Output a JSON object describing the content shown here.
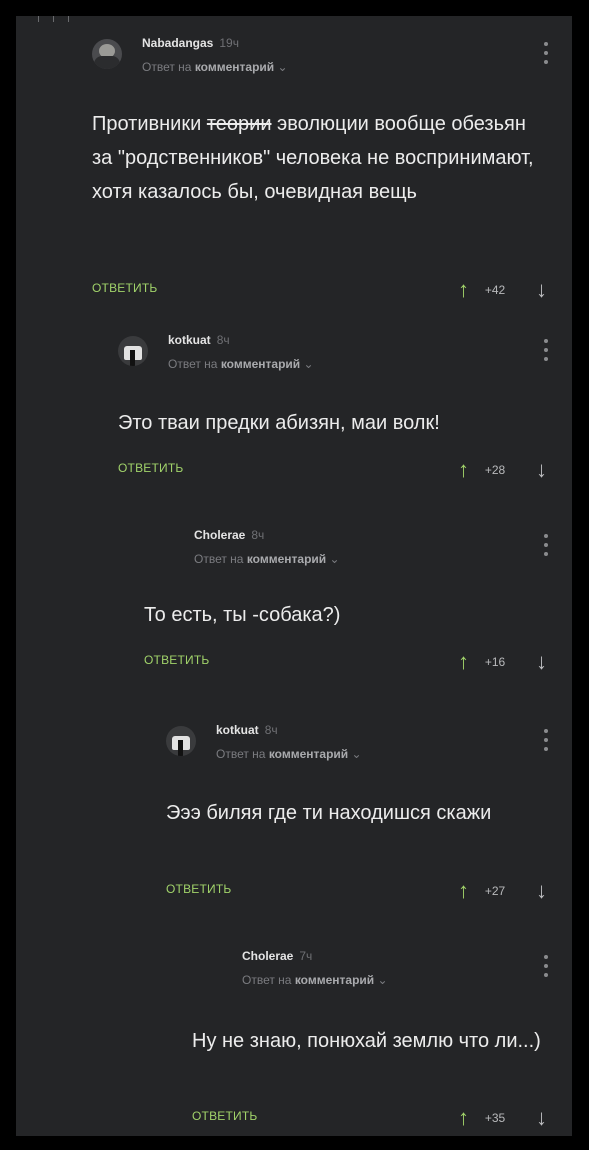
{
  "comments": [
    {
      "username": "Nabadangas",
      "time": "19ч",
      "reply_prefix": "Ответ на",
      "reply_link": "комментарий",
      "reply_chevron": "⌄",
      "text_before": "Противники ",
      "text_strike": "теории",
      "text_after": " эволюции вообще обезьян за \"родственников\" человека не воспринимают, хотя казалось бы, очевидная вещь",
      "reply_label": "ОТВЕТИТЬ",
      "score": "+42",
      "avatar_icon": "man-avatar"
    },
    {
      "username": "kotkuat",
      "time": "8ч",
      "reply_prefix": "Ответ на",
      "reply_link": "комментарий",
      "reply_chevron": "⌄",
      "text": "Это тваи предки абизян, маи волк!",
      "reply_label": "ОТВЕТИТЬ",
      "score": "+28",
      "avatar_icon": "cat-avatar"
    },
    {
      "username": "Cholerae",
      "time": "8ч",
      "reply_prefix": "Ответ на",
      "reply_link": "комментарий",
      "reply_chevron": "⌄",
      "text": "То есть, ты -собака?)",
      "reply_label": "ОТВЕТИТЬ",
      "score": "+16",
      "avatar_icon": "none"
    },
    {
      "username": "kotkuat",
      "time": "8ч",
      "reply_prefix": "Ответ на",
      "reply_link": "комментарий",
      "reply_chevron": "⌄",
      "text": "Эээ биляя где ти находишся скажи",
      "reply_label": "ОТВЕТИТЬ",
      "score": "+27",
      "avatar_icon": "cat-avatar"
    },
    {
      "username": "Cholerae",
      "time": "7ч",
      "reply_prefix": "Ответ на",
      "reply_link": "комментарий",
      "reply_chevron": "⌄",
      "text": "Ну не знаю, понюхай землю что ли...)",
      "reply_label": "ОТВЕТИТЬ",
      "score": "+35",
      "avatar_icon": "none"
    }
  ],
  "icons": {
    "upvote": "↑",
    "downvote": "↓",
    "more": "more-vert-icon"
  },
  "colors": {
    "background": "#242527",
    "accent": "#a1d36a",
    "text": "#ececec",
    "muted": "#7b7c80"
  }
}
